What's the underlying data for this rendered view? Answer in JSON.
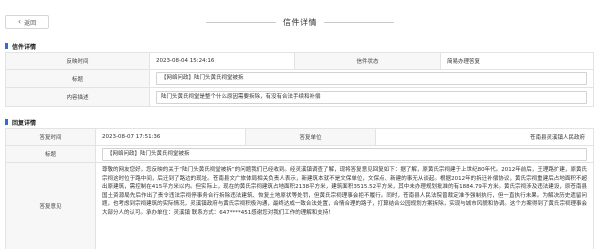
{
  "header": {
    "back_label": "返回",
    "title": "信件详情"
  },
  "letter_section": {
    "heading": "信件详情",
    "rows": {
      "time_label": "反映时间",
      "time_value": "2023-08-04 15:24:16",
      "status_label": "信件状态",
      "status_value": "简易办理答复",
      "title_label": "标题",
      "title_value": "【网络问政】陆门头黄氏祠堂被拆",
      "content_label": "内容描述",
      "content_value": "陆门头黄氏祠堂是整个什么原因需要拆除，有没有合法手续和补偿"
    }
  },
  "reply_section": {
    "heading": "回复详情",
    "rows": {
      "reply_time_label": "答复时间",
      "reply_time_value": "2023-08-07 17:51:36",
      "unit_label": "答复单位",
      "unit_value": "苍南县灵溪镇人民政府",
      "title_label": "标题",
      "title_value": "【网络问政】陆门头黄氏祠堂被拆",
      "opinion_label": "答复意见",
      "opinion_value": "尊敬的网友您好，您反映的关于“陆门头黄氏祠堂被拆”的问题我们已经收到。经灵溪镇调查了解，现将答复意见回复如下：据了解，原黄氏宗祠建于上世纪80年代。2012年前后，王理路扩建，原黄氏宗祠这时位于路中间，后迁到了路边的现址。苍南县文广旅体局相关负责人表示，新建筑本就不是文保单位，文保点、新建的事无从谈起。根据2012年的拆迁补偿协议，黄氏宗祠重建后占地面积不超出原建筑，需控制在415平方米以内。但实际上，现在的黄氏宗祠建筑占地面积2138平方米，建筑面积3515.52平方米，其中未办理规划批准的有1884.79平方米。黄氏宗祠涉及违法建设，原苍南县国土资源局先后作出了责令违法宗祠停事务合行拆除违法建筑、恢复土地原状等处罚，但黄氏宗祠理事会拒不履行。同时，苍南县人民法院曾裁定准予强制执行，但一直执行未果。为解决历史遗留问题，也考虑到宗祠建筑的实际情况，灵溪镇政府与黄氏宗祠积极沟通，最终达成一致合法处置，合情合理的路子，打算结合公园规划方案拆除，实现与城市风貌和协调。这个方案得到了黄氏宗祠理事会大部分人的认可。承办单位：灵溪镇 联系方式：647****451感谢您对我们工作的理解和支持！"
    }
  }
}
